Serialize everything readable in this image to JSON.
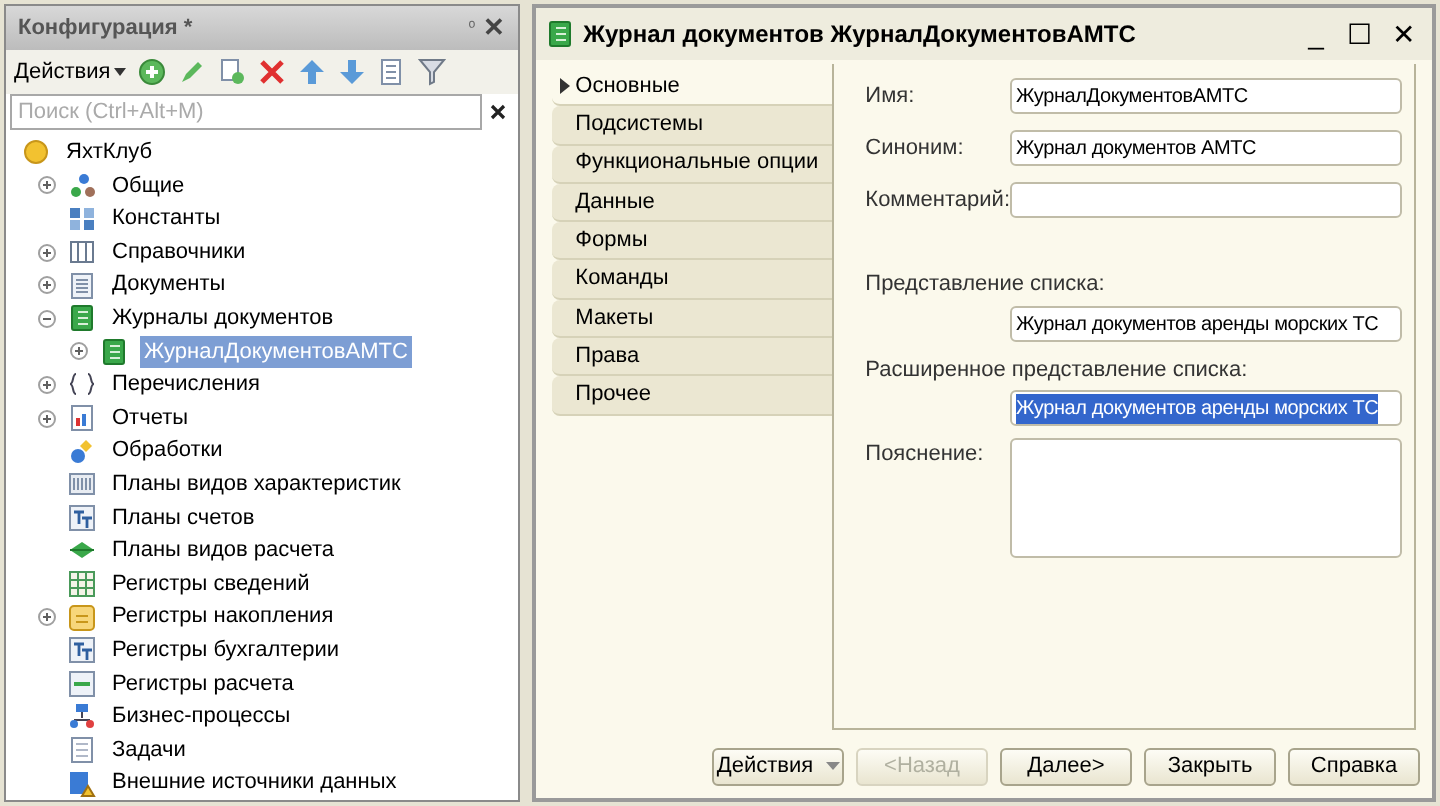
{
  "config_panel": {
    "title": "Конфигурация *",
    "pin": "ᵒ",
    "close": "✕",
    "actions_label": "Действия",
    "search": {
      "placeholder": "Поиск (Ctrl+Alt+M)"
    },
    "tree": {
      "label": "ЯхтКлуб",
      "kind": "root",
      "selected": false,
      "children": [
        {
          "label": "Общие",
          "kind": "common",
          "expanded": false,
          "selected": false
        },
        {
          "label": "Константы",
          "kind": "constants",
          "selected": false
        },
        {
          "label": "Справочники",
          "kind": "catalogs",
          "expanded": false,
          "selected": false
        },
        {
          "label": "Документы",
          "kind": "documents",
          "expanded": false,
          "selected": false
        },
        {
          "label": "Журналы документов",
          "kind": "journal",
          "expanded": true,
          "selected": false,
          "children": [
            {
              "label": "ЖурналДокументовАМТС",
              "kind": "journal",
              "expanded": false,
              "selected": true
            }
          ]
        },
        {
          "label": "Перечисления",
          "kind": "enums",
          "expanded": false,
          "selected": false
        },
        {
          "label": "Отчеты",
          "kind": "reports",
          "expanded": false,
          "selected": false
        },
        {
          "label": "Обработки",
          "kind": "processing",
          "selected": false
        },
        {
          "label": "Планы видов характеристик",
          "kind": "chart",
          "selected": false
        },
        {
          "label": "Планы счетов",
          "kind": "accounts",
          "selected": false
        },
        {
          "label": "Планы видов расчета",
          "kind": "calc",
          "selected": false
        },
        {
          "label": "Регистры сведений",
          "kind": "grid",
          "selected": false
        },
        {
          "label": "Регистры накопления",
          "kind": "accum",
          "expanded": false,
          "selected": false
        },
        {
          "label": "Регистры бухгалтерии",
          "kind": "accounts",
          "selected": false
        },
        {
          "label": "Регистры расчета",
          "kind": "calcreg",
          "selected": false
        },
        {
          "label": "Бизнес-процессы",
          "kind": "bp",
          "selected": false
        },
        {
          "label": "Задачи",
          "kind": "tasks",
          "selected": false
        },
        {
          "label": "Внешние источники данных",
          "kind": "external",
          "selected": false
        }
      ]
    }
  },
  "editor": {
    "title": "Журнал документов ЖурналДокументовАМТС",
    "controls": [
      "_",
      "☐",
      "✕"
    ],
    "tabs": [
      {
        "label": "Основные",
        "selected": true
      },
      {
        "label": "Подсистемы",
        "selected": false
      },
      {
        "label": "Функциональные опции",
        "selected": false
      },
      {
        "label": "Данные",
        "selected": false
      },
      {
        "label": "Формы",
        "selected": false
      },
      {
        "label": "Команды",
        "selected": false
      },
      {
        "label": "Макеты",
        "selected": false
      },
      {
        "label": "Права",
        "selected": false
      },
      {
        "label": "Прочее",
        "selected": false
      }
    ],
    "fields": [
      {
        "kind": "inline",
        "label": "Имя:",
        "value": "ЖурналДокументовАМТС"
      },
      {
        "kind": "inline",
        "label": "Синоним:",
        "value": "Журнал документов АМТС"
      },
      {
        "kind": "inline",
        "label": "Комментарий:"
      },
      {
        "kind": "gap"
      },
      {
        "kind": "stacked",
        "label": "Представление списка:",
        "value": "Журнал документов аренды морских ТС"
      },
      {
        "kind": "stacked",
        "label": "Расширенное представление списка:",
        "value": "Журнал документов аренды морских ТС",
        "highlighted": true
      },
      {
        "kind": "area",
        "label": "Пояснение:"
      }
    ],
    "buttons": [
      {
        "label": "Действия",
        "kind": "dropdown",
        "disabled": false
      },
      {
        "label": "<Назад",
        "kind": "plain",
        "disabled": true
      },
      {
        "label": "Далее>",
        "kind": "plain",
        "disabled": false
      },
      {
        "label": "Закрыть",
        "kind": "plain",
        "disabled": false
      },
      {
        "label": "Справка",
        "kind": "plain",
        "disabled": false
      }
    ]
  }
}
